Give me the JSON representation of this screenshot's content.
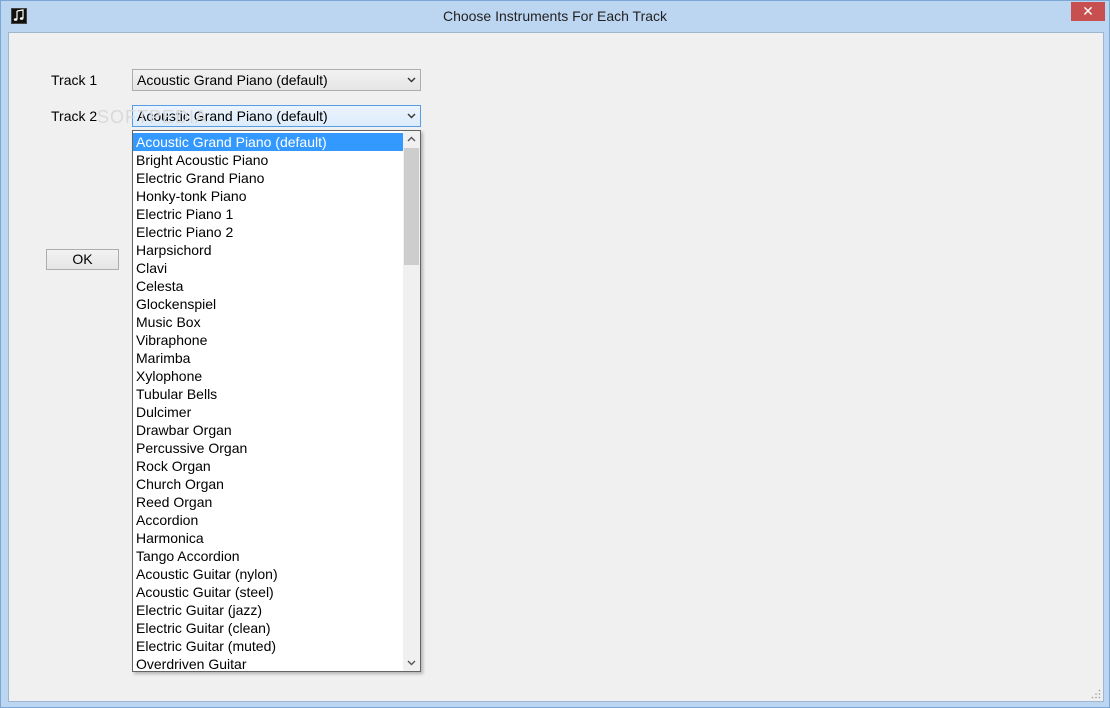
{
  "window": {
    "title": "Choose Instruments For Each Track",
    "close_symbol": "✕",
    "icon": "music-note-icon"
  },
  "tracks": [
    {
      "label": "Track 1",
      "selected": "Acoustic Grand Piano (default)"
    },
    {
      "label": "Track 2",
      "selected": "Acoustic Grand Piano (default)"
    }
  ],
  "ok_label": "OK",
  "watermark": "SOFTPEDIA",
  "dropdown": {
    "selected_index": 0,
    "items": [
      "Acoustic Grand Piano (default)",
      "Bright Acoustic Piano",
      "Electric Grand Piano",
      "Honky-tonk Piano",
      "Electric Piano 1",
      "Electric Piano 2",
      "Harpsichord",
      "Clavi",
      "Celesta",
      "Glockenspiel",
      "Music Box",
      "Vibraphone",
      "Marimba",
      "Xylophone",
      "Tubular Bells",
      "Dulcimer",
      "Drawbar Organ",
      "Percussive Organ",
      "Rock Organ",
      "Church Organ",
      "Reed Organ",
      "Accordion",
      "Harmonica",
      "Tango Accordion",
      "Acoustic Guitar (nylon)",
      "Acoustic Guitar (steel)",
      "Electric Guitar (jazz)",
      "Electric Guitar (clean)",
      "Electric Guitar (muted)",
      "Overdriven Guitar"
    ]
  },
  "colors": {
    "selection": "#3399ff",
    "close_button": "#c74f4f",
    "frame": "#bcd6f2"
  }
}
